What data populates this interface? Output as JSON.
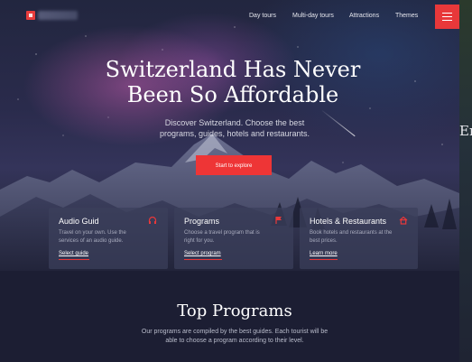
{
  "nav": {
    "brand": "",
    "links": [
      "Day tours",
      "Multi-day tours",
      "Attractions",
      "Themes"
    ]
  },
  "hero": {
    "title_line1": "Switzerland Has Never",
    "title_line2": "Been So Affordable",
    "subtitle": "Discover Switzerland. Choose the best programs, guides, hotels and restaurants.",
    "cta": "Start to explore"
  },
  "cards": [
    {
      "title": "Audio Guid",
      "icon": "headphones-icon",
      "description": "Travel on your own. Use the services of an audio guide.",
      "link": "Select guide"
    },
    {
      "title": "Programs",
      "icon": "flag-icon",
      "description": "Choose a travel program that is right for you.",
      "link": "Select program"
    },
    {
      "title": "Hotels & Restaurants",
      "icon": "home-icon",
      "description": "Book hotels and restaurants at the best prices.",
      "link": "Learn more"
    }
  ],
  "programs": {
    "title": "Top Programs",
    "description": "Our programs are compiled by the best guides. Each tourist will be able to choose a program according to their level."
  },
  "side_peek": "Er",
  "colors": {
    "accent": "#e8383a",
    "background": "#1c1e33"
  }
}
